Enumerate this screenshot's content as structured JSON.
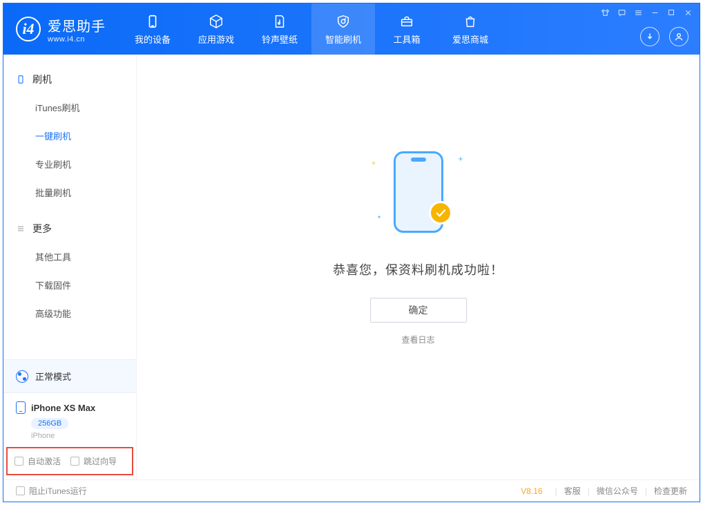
{
  "app": {
    "title": "爱思助手",
    "subtitle": "www.i4.cn"
  },
  "nav": [
    {
      "label": "我的设备"
    },
    {
      "label": "应用游戏"
    },
    {
      "label": "铃声壁纸"
    },
    {
      "label": "智能刷机"
    },
    {
      "label": "工具箱"
    },
    {
      "label": "爱思商城"
    }
  ],
  "sidebar": {
    "group1": {
      "title": "刷机",
      "items": [
        {
          "label": "iTunes刷机"
        },
        {
          "label": "一键刷机",
          "active": true
        },
        {
          "label": "专业刷机"
        },
        {
          "label": "批量刷机"
        }
      ]
    },
    "group2": {
      "title": "更多",
      "items": [
        {
          "label": "其他工具"
        },
        {
          "label": "下载固件"
        },
        {
          "label": "高级功能"
        }
      ]
    },
    "mode": "正常模式",
    "device": {
      "name": "iPhone XS Max",
      "capacity": "256GB",
      "type": "iPhone"
    },
    "checkboxes": {
      "auto_activate": "自动激活",
      "skip_guide": "跳过向导"
    }
  },
  "main": {
    "success_text": "恭喜您，保资料刷机成功啦！",
    "ok_button": "确定",
    "view_log": "查看日志"
  },
  "footer": {
    "block_itunes": "阻止iTunes运行",
    "version": "V8.16",
    "links": {
      "support": "客服",
      "wechat": "微信公众号",
      "check_update": "检查更新"
    }
  }
}
